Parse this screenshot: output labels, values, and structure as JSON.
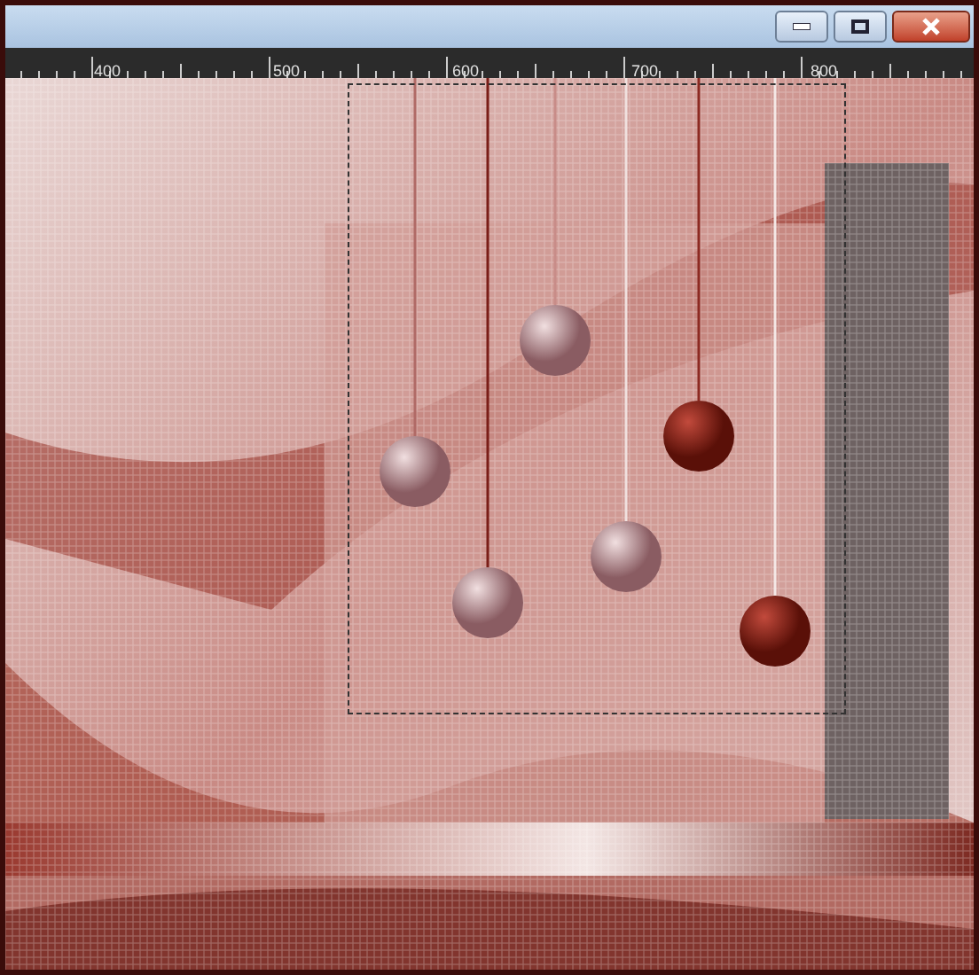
{
  "ruler": {
    "labels": [
      "400",
      "500",
      "600",
      "700",
      "800"
    ]
  }
}
